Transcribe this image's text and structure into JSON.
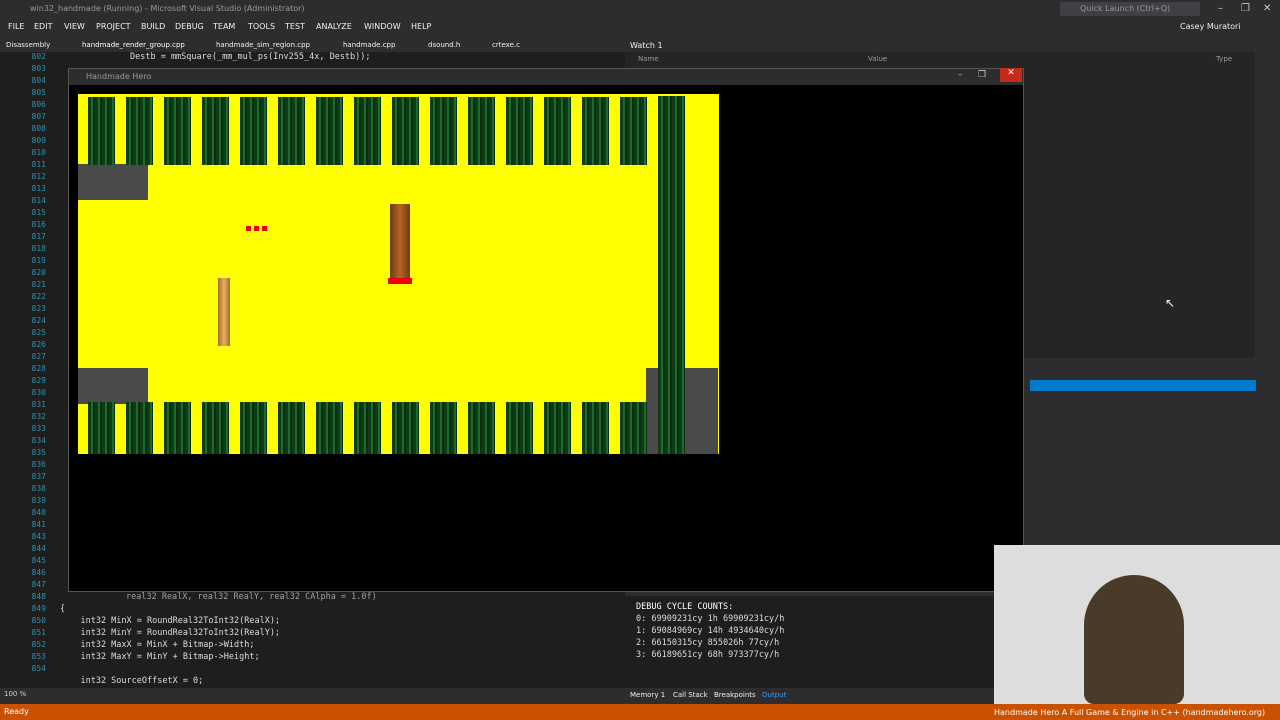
{
  "window": {
    "title": "win32_handmade (Running) - Microsoft Visual Studio (Administrator)",
    "quick_launch": "Quick Launch (Ctrl+Q)",
    "user": "Casey Muratori"
  },
  "menu": [
    "FILE",
    "EDIT",
    "VIEW",
    "PROJECT",
    "BUILD",
    "DEBUG",
    "TEAM",
    "TOOLS",
    "TEST",
    "ANALYZE",
    "WINDOW",
    "HELP"
  ],
  "tabs": [
    "Disassembly",
    "handmade_render_group.cpp",
    "handmade_sim_region.cpp",
    "handmade.cpp",
    "dsound.h",
    "crtexe.c"
  ],
  "watch": {
    "title": "Watch 1",
    "col_name": "Name",
    "col_value": "Value",
    "col_type": "Type"
  },
  "editor": {
    "line_numbers": [
      "802",
      "803",
      "804",
      "805",
      "806",
      "807",
      "808",
      "809",
      "810",
      "811",
      "812",
      "813",
      "814",
      "815",
      "816",
      "817",
      "818",
      "819",
      "820",
      "821",
      "822",
      "823",
      "824",
      "825",
      "826",
      "827",
      "828",
      "829",
      "830",
      "831",
      "832",
      "833",
      "834",
      "835",
      "836",
      "837",
      "838",
      "839",
      "840",
      "841",
      "843",
      "844",
      "845",
      "846",
      "847",
      "848",
      "849",
      "850",
      "851",
      "852",
      "853",
      "854"
    ],
    "top_line": "Destb = mmSquare(_mm_mul_ps(Inv255_4x, Destb));",
    "lines": [
      "real32 RealX, real32 RealY, real32 CAlpha = 1.0f)",
      "{",
      "    int32 MinX = RoundReal32ToInt32(RealX);",
      "    int32 MinY = RoundReal32ToInt32(RealY);",
      "    int32 MaxX = MinX + Bitmap->Width;",
      "    int32 MaxY = MinY + Bitmap->Height;",
      "",
      "    int32 SourceOffsetX = 0;"
    ]
  },
  "game": {
    "title": "Handmade Hero"
  },
  "output": {
    "header": "DEBUG CYCLE COUNTS:",
    "lines": [
      "0: 69909231cy 1h 69909231cy/h",
      "1: 69084969cy 14h 4934640cy/h",
      "2: 66150315cy 855026h 77cy/h",
      "3: 66189651cy 68h 973377cy/h"
    ]
  },
  "bottom_tabs": [
    "Memory 1",
    "Call Stack",
    "Breakpoints",
    "Output"
  ],
  "status": {
    "text": "Ready",
    "zoom": "100 %"
  },
  "caption": "Handmade Hero    A Full Game & Engine in C++    (handmadehero.org)"
}
